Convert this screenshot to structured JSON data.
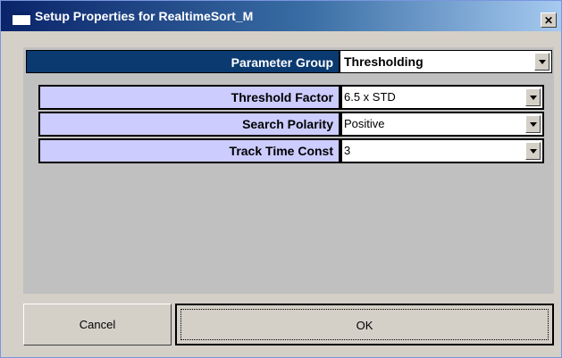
{
  "window": {
    "title": "Setup Properties for RealtimeSort_M"
  },
  "parameter_group": {
    "label": "Parameter Group",
    "value": "Thresholding"
  },
  "params": [
    {
      "label": "Threshold Factor",
      "value": "6.5 x STD"
    },
    {
      "label": "Search Polarity",
      "value": "Positive"
    },
    {
      "label": "Track Time Const",
      "value": "3"
    }
  ],
  "buttons": {
    "cancel": "Cancel",
    "ok": "OK"
  },
  "icons": {
    "close": "close-icon",
    "dropdown": "chevron-down-icon"
  },
  "colors": {
    "group_header": "#0a3a70",
    "param_label_bg": "#ccccff"
  }
}
